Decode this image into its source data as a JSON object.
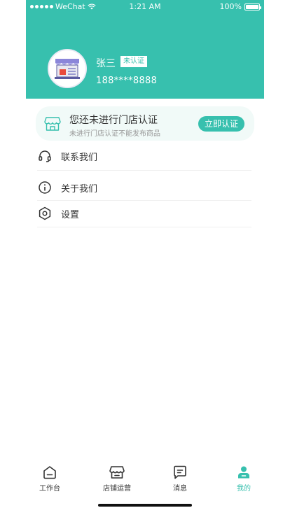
{
  "status_bar": {
    "carrier": "WeChat",
    "time": "1:21 AM",
    "battery": "100%"
  },
  "profile": {
    "name": "张三",
    "cert_status": "未认证",
    "phone": "188****8888"
  },
  "cert_banner": {
    "title": "您还未进行门店认证",
    "subtitle": "未进行门店认证不能发布商品",
    "button": "立即认证"
  },
  "menu": [
    {
      "label": "联系我们",
      "icon": "headset-icon"
    },
    {
      "label": "关于我们",
      "icon": "info-icon"
    },
    {
      "label": "设置",
      "icon": "gear-icon"
    }
  ],
  "tabs": [
    {
      "label": "工作台",
      "icon": "workbench-icon",
      "active": false
    },
    {
      "label": "店铺运营",
      "icon": "store-icon",
      "active": false
    },
    {
      "label": "消息",
      "icon": "message-icon",
      "active": false
    },
    {
      "label": "我的",
      "icon": "user-icon",
      "active": true
    }
  ],
  "colors": {
    "accent": "#37c0ae",
    "banner_bg": "#f1faf8",
    "text": "#333333",
    "muted": "#999999"
  }
}
